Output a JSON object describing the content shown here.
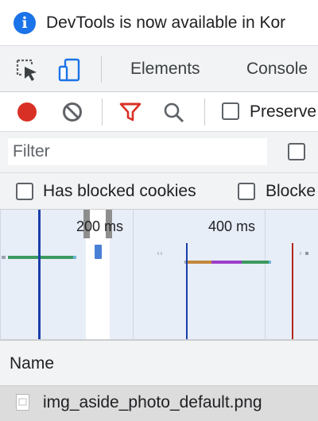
{
  "infobar": {
    "message": "DevTools is now available in Kor",
    "icon": "info-icon",
    "icon_color": "#1a73e8"
  },
  "toolbar": {
    "tabs": [
      {
        "label": "Elements"
      },
      {
        "label": "Console"
      }
    ],
    "icons": [
      "inspect-element-icon",
      "device-toolbar-icon"
    ],
    "device_toolbar_active_color": "#1a73e8"
  },
  "network_toolbar": {
    "record_color": "#d93025",
    "filter_icon_color": "#d93025",
    "preserve_log_label": "Preserve"
  },
  "filter": {
    "placeholder": "Filter"
  },
  "blocked": {
    "has_blocked_cookies_label": "Has blocked cookies",
    "blocked_requests_label": "Blocke"
  },
  "overview": {
    "ticks": [
      "200 ms",
      "400 ms"
    ],
    "dom_content_loaded_color": "#1a3ea8",
    "load_color": "#b3261e"
  },
  "table": {
    "column_name": "Name",
    "rows": [
      {
        "name": "img_aside_photo_default.png"
      }
    ]
  }
}
